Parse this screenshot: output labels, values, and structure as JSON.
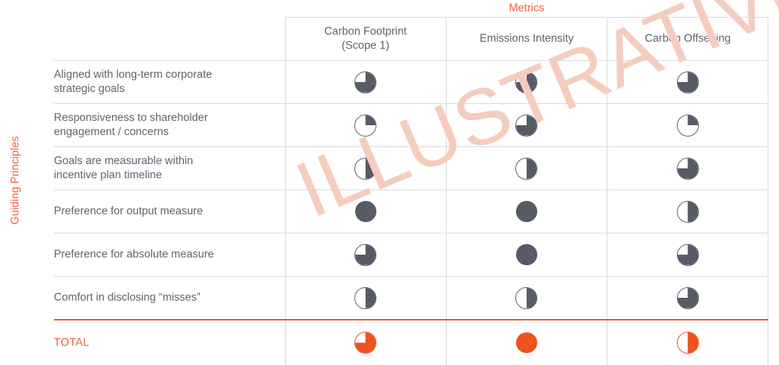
{
  "axis": {
    "row_axis_label": "Guiding Principles",
    "column_axis_label": "Metrics"
  },
  "watermark": {
    "text": "ILLUSTRATIVE",
    "color": "#f5cdbe"
  },
  "colors": {
    "accent_orange": "#f4613e",
    "ball_orange": "#ef5120",
    "ball_dark": "#575b66",
    "grid": "#d8d8d8",
    "text": "#5f636d"
  },
  "table": {
    "row_header_label": "",
    "columns": [
      {
        "label": "Carbon Footprint\n(Scope 1)",
        "line1": "Carbon Footprint",
        "line2": "(Scope 1)"
      },
      {
        "label": "Emissions Intensity",
        "line1": "Emissions Intensity",
        "line2": ""
      },
      {
        "label": "Carbon Offsetting",
        "line1": "Carbon Offsetting",
        "line2": ""
      }
    ],
    "rows": [
      {
        "label_line1": "Aligned with long-term corporate",
        "label_line2": "strategic goals",
        "ratings": [
          {
            "level": 3,
            "level_text": "three-quarters",
            "style": "dark"
          },
          {
            "level": 3,
            "level_text": "three-quarters",
            "style": "dark"
          },
          {
            "level": 3,
            "level_text": "three-quarters",
            "style": "dark"
          }
        ]
      },
      {
        "label_line1": "Responsiveness to shareholder",
        "label_line2": "engagement / concerns",
        "ratings": [
          {
            "level": 1,
            "level_text": "one-quarter",
            "style": "dark"
          },
          {
            "level": 3,
            "level_text": "three-quarters",
            "style": "dark"
          },
          {
            "level": 1,
            "level_text": "one-quarter",
            "style": "dark"
          }
        ]
      },
      {
        "label_line1": "Goals are measurable within",
        "label_line2": "incentive plan timeline",
        "ratings": [
          {
            "level": 2,
            "level_text": "one-half",
            "style": "dark"
          },
          {
            "level": 2,
            "level_text": "one-half",
            "style": "dark"
          },
          {
            "level": 3,
            "level_text": "three-quarters",
            "style": "dark"
          }
        ]
      },
      {
        "label_line1": "Preference for output measure",
        "label_line2": "",
        "ratings": [
          {
            "level": 4,
            "level_text": "full",
            "style": "dark"
          },
          {
            "level": 4,
            "level_text": "full",
            "style": "dark"
          },
          {
            "level": 2,
            "level_text": "one-half",
            "style": "dark"
          }
        ]
      },
      {
        "label_line1": "Preference for absolute measure",
        "label_line2": "",
        "ratings": [
          {
            "level": 3,
            "level_text": "three-quarters",
            "style": "dark"
          },
          {
            "level": 4,
            "level_text": "full",
            "style": "dark"
          },
          {
            "level": 3,
            "level_text": "three-quarters",
            "style": "dark"
          }
        ]
      },
      {
        "label_line1": "Comfort in disclosing “misses”",
        "label_line2": "",
        "ratings": [
          {
            "level": 2,
            "level_text": "one-half",
            "style": "dark"
          },
          {
            "level": 2,
            "level_text": "one-half",
            "style": "dark"
          },
          {
            "level": 3,
            "level_text": "three-quarters",
            "style": "dark"
          }
        ]
      }
    ],
    "total_row": {
      "label": "TOTAL",
      "ratings": [
        {
          "level": 3,
          "level_text": "three-quarters",
          "style": "orange"
        },
        {
          "level": 4,
          "level_text": "full",
          "style": "orange"
        },
        {
          "level": 2,
          "level_text": "one-half",
          "style": "orange"
        }
      ]
    }
  },
  "chart_data": {
    "type": "heatmap",
    "title": "",
    "xlabel": "Metrics",
    "ylabel": "Guiding Principles",
    "scale": {
      "min": 0,
      "max": 4,
      "levels": [
        {
          "value": 0,
          "name": "empty"
        },
        {
          "value": 1,
          "name": "one-quarter"
        },
        {
          "value": 2,
          "name": "one-half"
        },
        {
          "value": 3,
          "name": "three-quarters"
        },
        {
          "value": 4,
          "name": "full"
        }
      ],
      "glyph": "harvey-ball"
    },
    "categories": [
      "Carbon Footprint (Scope 1)",
      "Emissions Intensity",
      "Carbon Offsetting"
    ],
    "rows": [
      "Aligned with long-term corporate strategic goals",
      "Responsiveness to shareholder engagement / concerns",
      "Goals are measurable within incentive plan timeline",
      "Preference for output measure",
      "Preference for absolute measure",
      "Comfort in disclosing “misses”",
      "TOTAL"
    ],
    "values": [
      [
        3,
        3,
        3
      ],
      [
        1,
        3,
        1
      ],
      [
        2,
        2,
        3
      ],
      [
        4,
        4,
        2
      ],
      [
        3,
        4,
        3
      ],
      [
        2,
        2,
        3
      ],
      [
        3,
        4,
        2
      ]
    ],
    "grid": true,
    "legend": "none",
    "annotations": [
      "ILLUSTRATIVE"
    ]
  }
}
